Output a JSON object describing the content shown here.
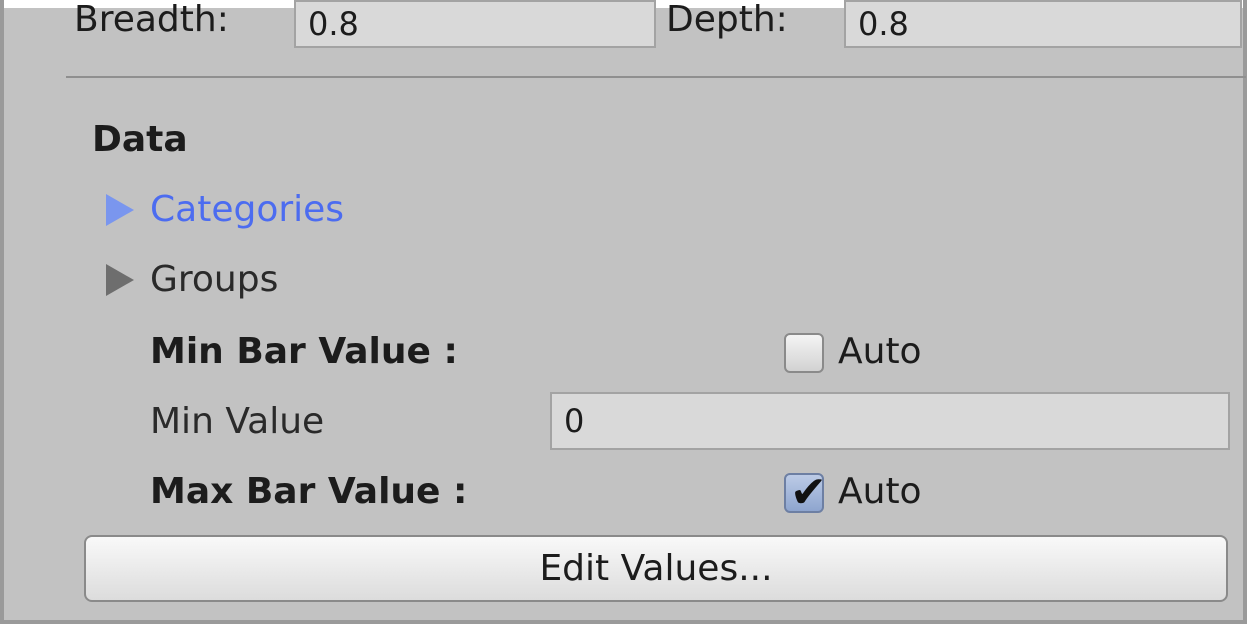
{
  "dimensions": {
    "breadth_label": "Breadth:",
    "breadth_value": "0.8",
    "depth_label": "Depth:",
    "depth_value": "0.8"
  },
  "data_section": {
    "heading": "Data",
    "categories_label": "Categories",
    "groups_label": "Groups",
    "min_bar_label": "Min Bar Value :",
    "min_auto_label": "Auto",
    "min_auto_checked": false,
    "min_value_label": "Min Value",
    "min_value": "0",
    "max_bar_label": "Max Bar Value :",
    "max_auto_label": "Auto",
    "max_auto_checked": true,
    "edit_values_button": "Edit Values..."
  },
  "colors": {
    "panel_bg": "#c2c2c2",
    "link_blue": "#4c6cf0",
    "foldout_blue": "#7a96ee",
    "checkbox_checked": "#8ea5cf"
  },
  "icons": {
    "categories_foldout": "triangle-right-icon",
    "groups_foldout": "triangle-right-icon",
    "max_auto_check": "checkmark-icon"
  }
}
